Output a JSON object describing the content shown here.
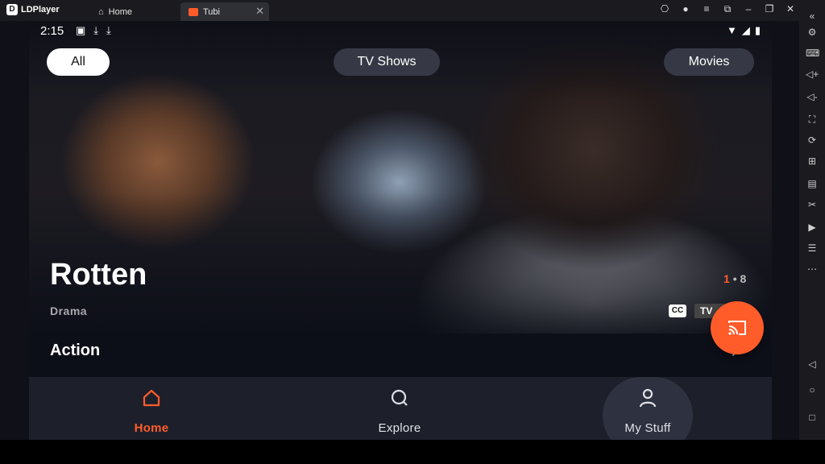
{
  "emulator": {
    "app_name": "LDPlayer",
    "tabs": [
      {
        "label": "Home"
      },
      {
        "label": "Tubi"
      }
    ],
    "window_controls": [
      "gamepad-icon",
      "user-icon",
      "menu-icon",
      "screen-icon",
      "minimize-icon",
      "restore-icon",
      "close-icon"
    ],
    "sidebar_icons": [
      "collapse-icon",
      "settings-icon",
      "keyboard-icon",
      "volume-up-icon",
      "volume-down-icon",
      "screenshot-icon",
      "sync-icon",
      "install-apk-icon",
      "rpk-icon",
      "cut-icon",
      "video-icon",
      "notes-icon",
      "more-icon",
      "back-icon",
      "home-icon",
      "recents-icon"
    ]
  },
  "statusbar": {
    "time": "2:15"
  },
  "filters": {
    "all": "All",
    "tv_shows": "TV Shows",
    "movies": "Movies",
    "selected": "All"
  },
  "hero": {
    "title": "Rotten",
    "genre": "Drama",
    "page_current": "1",
    "page_separator": "•",
    "page_total": "8",
    "badge_cc": "CC",
    "badge_rating": "TV"
  },
  "section": {
    "title": "Action",
    "arrow": "›"
  },
  "nav": {
    "home": "Home",
    "explore": "Explore",
    "my_stuff": "My Stuff",
    "active": "Home"
  },
  "colors": {
    "accent": "#ff5c2a",
    "nav_bg": "#1d202b",
    "screen_bg": "#0d0f18"
  }
}
